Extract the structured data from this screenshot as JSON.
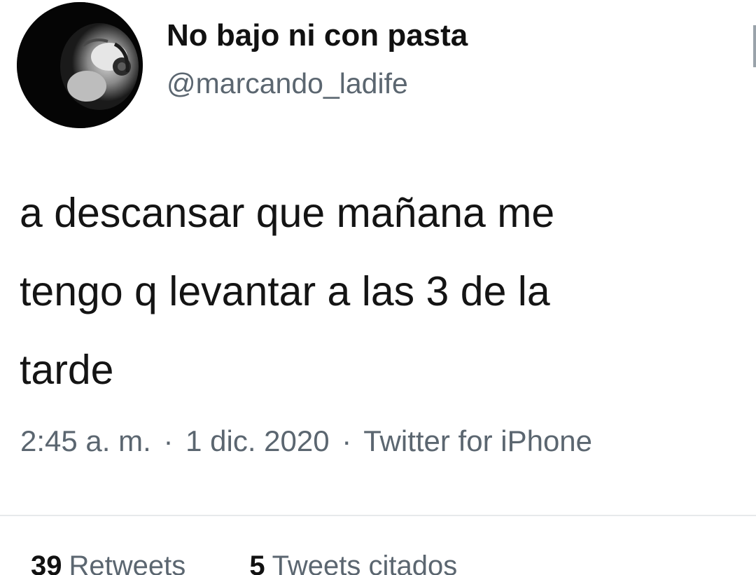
{
  "tweet": {
    "author": {
      "display_name": "No bajo ni con pasta",
      "handle": "@marcando_ladife"
    },
    "text": "a descansar que mañana me\ntengo q levantar a las 3 de la\ntarde",
    "time": "2:45 a. m.",
    "separator": "·",
    "date": "1 dic. 2020",
    "source": "Twitter for iPhone",
    "stats": {
      "retweets_count": "39",
      "retweets_label": "Retweets",
      "quotes_count": "5",
      "quotes_label": "Tweets citados"
    }
  },
  "colors": {
    "text": "#141414",
    "secondary": "#5b6670",
    "divider": "#e7e9eb",
    "background": "#ffffff"
  },
  "icons": {
    "avatar": "profile-photo",
    "more": "more-dots-icon"
  }
}
